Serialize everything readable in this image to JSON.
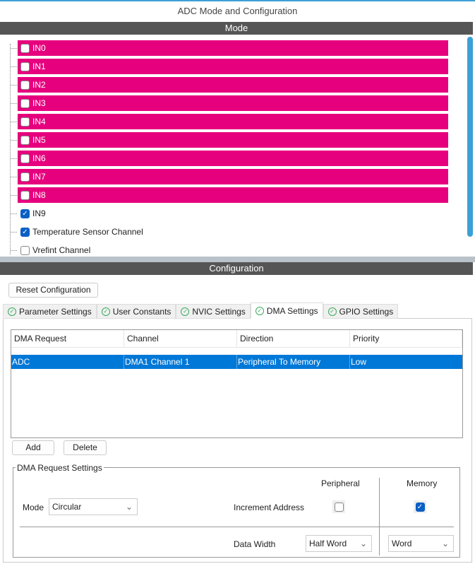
{
  "window": {
    "title": "ADC Mode and Configuration"
  },
  "mode": {
    "header": "Mode",
    "channels": [
      {
        "label": "IN0",
        "checked": false,
        "highlighted": true
      },
      {
        "label": "IN1",
        "checked": false,
        "highlighted": true
      },
      {
        "label": "IN2",
        "checked": false,
        "highlighted": true
      },
      {
        "label": "IN3",
        "checked": false,
        "highlighted": true
      },
      {
        "label": "IN4",
        "checked": false,
        "highlighted": true
      },
      {
        "label": "IN5",
        "checked": false,
        "highlighted": true
      },
      {
        "label": "IN6",
        "checked": false,
        "highlighted": true
      },
      {
        "label": "IN7",
        "checked": false,
        "highlighted": true
      },
      {
        "label": "IN8",
        "checked": false,
        "highlighted": true
      },
      {
        "label": "IN9",
        "checked": true,
        "highlighted": false
      },
      {
        "label": "Temperature Sensor Channel",
        "checked": true,
        "highlighted": false
      },
      {
        "label": "Vrefint Channel",
        "checked": false,
        "highlighted": false
      }
    ]
  },
  "configuration": {
    "header": "Configuration",
    "reset_label": "Reset Configuration",
    "tabs": [
      {
        "label": "Parameter Settings"
      },
      {
        "label": "User Constants"
      },
      {
        "label": "NVIC Settings"
      },
      {
        "label": "DMA Settings",
        "active": true
      },
      {
        "label": "GPIO Settings"
      }
    ]
  },
  "dma": {
    "columns": [
      "DMA Request",
      "Channel",
      "Direction",
      "Priority"
    ],
    "rows": [
      [
        "ADC",
        "DMA1 Channel 1",
        "Peripheral To Memory",
        "Low"
      ]
    ],
    "add_label": "Add",
    "delete_label": "Delete",
    "settings": {
      "title": "DMA Request Settings",
      "mode_label": "Mode",
      "mode_value": "Circular",
      "peripheral_label": "Peripheral",
      "memory_label": "Memory",
      "increment_label": "Increment Address",
      "peripheral_increment": false,
      "memory_increment": true,
      "data_width_label": "Data Width",
      "peripheral_width": "Half Word",
      "memory_width": "Word"
    }
  },
  "colors": {
    "highlight": "#e6007e",
    "selection": "#0078d7",
    "header_bar": "#545554"
  }
}
